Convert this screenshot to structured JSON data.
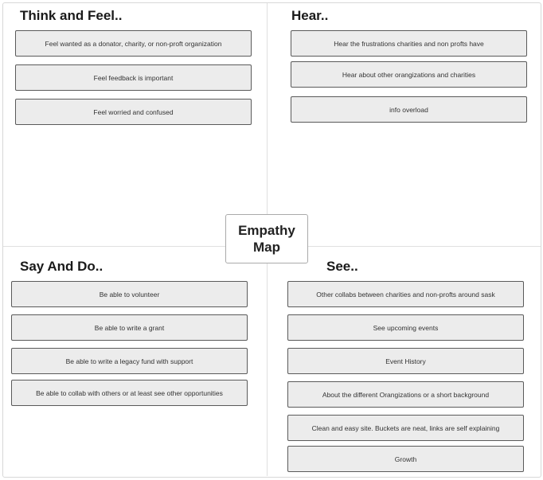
{
  "center": {
    "line1": "Empathy",
    "line2": "Map"
  },
  "quadrants": {
    "think_feel": {
      "title": "Think and Feel..",
      "notes": [
        "Feel wanted as a donator, charity, or non-proft organization",
        "Feel feedback is important",
        "Feel worried and confused"
      ]
    },
    "hear": {
      "title": "Hear..",
      "notes": [
        "Hear the frustrations charities and non profts have",
        "Hear about other orangizations and charities",
        "info overload"
      ]
    },
    "say_do": {
      "title": "Say And Do..",
      "notes": [
        "Be able to volunteer",
        "Be able to write a grant",
        "Be able to write a legacy fund with support",
        "Be able to collab with others or at least see other opportunities"
      ]
    },
    "see": {
      "title": "See..",
      "notes": [
        "Other collabs between charities and non-profts around sask",
        "See upcoming events",
        "Event History",
        "About the different Orangizations or a short background",
        "Clean and easy site. Buckets are neat, links are self explaining",
        "Growth"
      ]
    }
  }
}
